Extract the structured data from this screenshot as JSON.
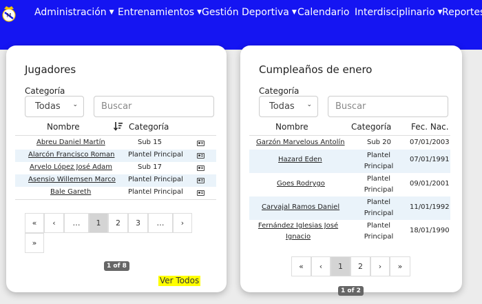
{
  "nav": {
    "items": [
      {
        "label": "Administración",
        "dropdown": true
      },
      {
        "label": "Entrenamientos",
        "dropdown": true
      },
      {
        "label": "Gestión Deportiva",
        "dropdown": true
      },
      {
        "label": "Calendario",
        "dropdown": false
      },
      {
        "label": "Interdisciplinario",
        "dropdown": true
      },
      {
        "label": "Reportes",
        "dropdown": false
      }
    ]
  },
  "colors": {
    "nav_bg": "#1515f2",
    "highlight": "#ffff00",
    "row_alt": "#eaf3fa"
  },
  "players": {
    "title": "Jugadores",
    "category_label": "Categoría",
    "category_value": "Todas",
    "search_placeholder": "Buscar",
    "headers": {
      "name": "Nombre",
      "category": "Categoría"
    },
    "rows": [
      {
        "name": "Abreu Daniel Martín",
        "category": "Sub 15"
      },
      {
        "name": "Alarcón Francisco Roman",
        "category": "Plantel Principal"
      },
      {
        "name": "Arvelo López José Adam",
        "category": "Sub 17"
      },
      {
        "name": "Asensio Willemsen Marco",
        "category": "Plantel Principal"
      },
      {
        "name": "Bale Gareth",
        "category": "Plantel Principal"
      }
    ],
    "pagination": {
      "first": "«",
      "prev": "‹",
      "ellipsis1": "…",
      "p1": "1",
      "p2": "2",
      "p3": "3",
      "ellipsis2": "…",
      "next": "›",
      "last": "»"
    },
    "page_badge": "1 of 8",
    "view_all": "Ver Todos"
  },
  "birthdays": {
    "title": "Cumpleaños de enero",
    "category_label": "Categoría",
    "category_value": "Todas",
    "search_placeholder": "Buscar",
    "headers": {
      "name": "Nombre",
      "category": "Categoría",
      "dob": "Fec. Nac."
    },
    "rows": [
      {
        "name": "Garzón Marvelous Antolín",
        "category": "Sub 20",
        "dob": "07/01/2003"
      },
      {
        "name": "Hazard Eden",
        "category": "Plantel Principal",
        "dob": "07/01/1991"
      },
      {
        "name": "Goes Rodrygo",
        "category": "Plantel Principal",
        "dob": "09/01/2001"
      },
      {
        "name": "Carvajal Ramos Daniel",
        "category": "Plantel Principal",
        "dob": "11/01/1992"
      },
      {
        "name": "Fernández Iglesias José Ignacio",
        "category": "Plantel Principal",
        "dob": "18/01/1990"
      }
    ],
    "pagination": {
      "first": "«",
      "prev": "‹",
      "p1": "1",
      "p2": "2",
      "next": "›",
      "last": "»"
    },
    "page_badge": "1 of 2"
  }
}
